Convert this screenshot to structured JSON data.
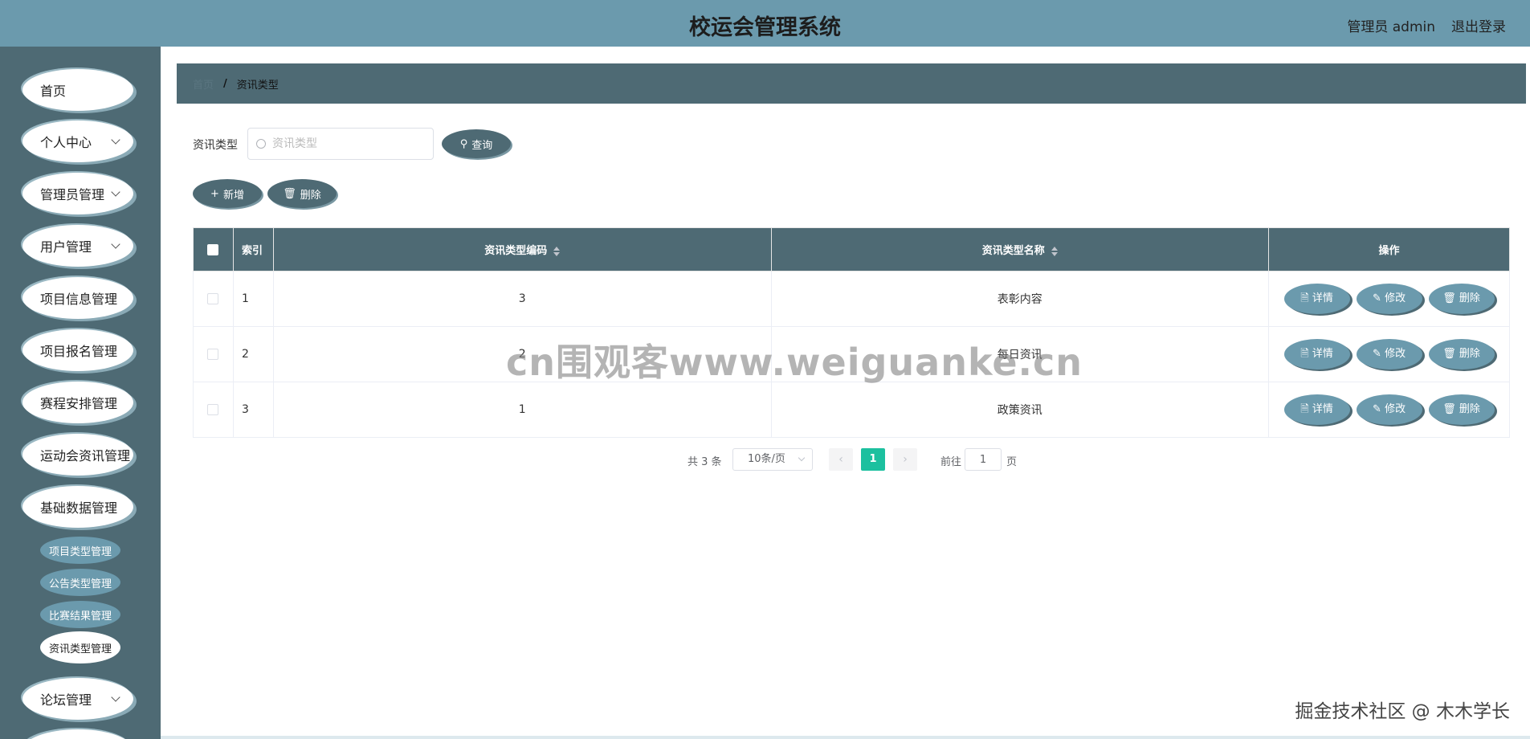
{
  "header": {
    "title": "校运会管理系统",
    "user": "管理员 admin",
    "logout": "退出登录"
  },
  "sidebar": {
    "items": [
      {
        "label": "首页",
        "has_children": false
      },
      {
        "label": "个人中心",
        "has_children": true
      },
      {
        "label": "管理员管理",
        "has_children": true
      },
      {
        "label": "用户管理",
        "has_children": true
      },
      {
        "label": "项目信息管理",
        "has_children": false
      },
      {
        "label": "项目报名管理",
        "has_children": false
      },
      {
        "label": "赛程安排管理",
        "has_children": false
      },
      {
        "label": "运动会资讯管理",
        "has_children": false
      },
      {
        "label": "基础数据管理",
        "has_children": false
      },
      {
        "label": "论坛管理",
        "has_children": true
      }
    ],
    "subitems": [
      {
        "label": "项目类型管理",
        "active": false
      },
      {
        "label": "公告类型管理",
        "active": false
      },
      {
        "label": "比赛结果管理",
        "active": false
      },
      {
        "label": "资讯类型管理",
        "active": true
      }
    ]
  },
  "breadcrumb": {
    "home": "首页",
    "separator": "/",
    "current": "资讯类型"
  },
  "search": {
    "label": "资讯类型",
    "placeholder": "资讯类型",
    "value": "",
    "button": "查询"
  },
  "toolbar": {
    "add": "新增",
    "delete": "删除"
  },
  "table": {
    "headers": {
      "index": "索引",
      "code": "资讯类型编码",
      "name": "资讯类型名称",
      "actions": "操作"
    },
    "rows": [
      {
        "index": "1",
        "code": "3",
        "name": "表彰内容"
      },
      {
        "index": "2",
        "code": "2",
        "name": "每日资讯"
      },
      {
        "index": "3",
        "code": "1",
        "name": "政策资讯"
      }
    ],
    "row_actions": {
      "detail": "详情",
      "edit": "修改",
      "delete": "删除"
    }
  },
  "pagination": {
    "total": "共 3 条",
    "page_size": "10条/页",
    "prev": "‹",
    "next": "›",
    "current_page": "1",
    "goto_label": "前往",
    "goto_value": "1",
    "page_word": "页"
  },
  "watermark": "cn围观客www.weiguanke.cn",
  "credit": "掘金技术社区 @ 木木学长",
  "colors": {
    "header": "#6b9aad",
    "sidebar": "#4e6a74",
    "accent": "#1cc09f"
  }
}
